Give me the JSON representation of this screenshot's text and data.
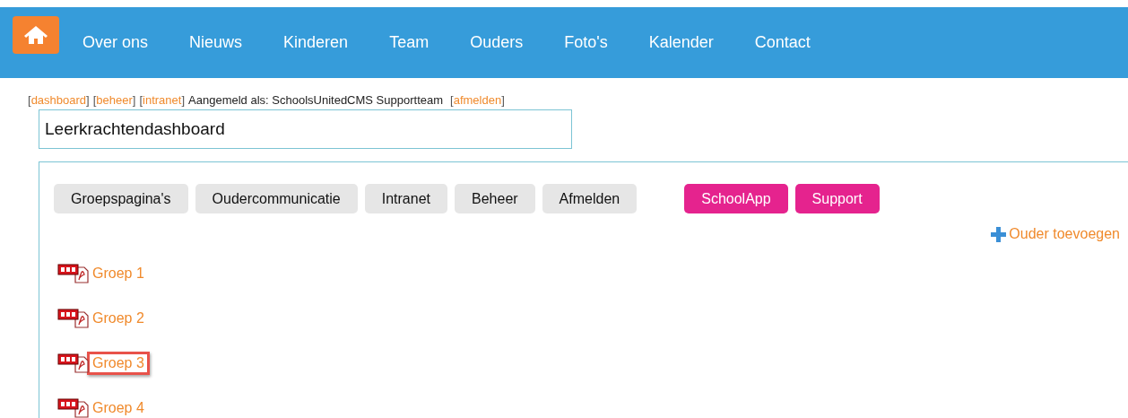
{
  "nav": {
    "items": [
      {
        "label": "Over ons"
      },
      {
        "label": "Nieuws"
      },
      {
        "label": "Kinderen"
      },
      {
        "label": "Team"
      },
      {
        "label": "Ouders"
      },
      {
        "label": "Foto's"
      },
      {
        "label": "Kalender"
      },
      {
        "label": "Contact"
      }
    ]
  },
  "login_bar": {
    "links": [
      {
        "open": "[",
        "label": "dashboard",
        "close": "]"
      },
      {
        "open": "[",
        "label": "beheer",
        "close": "]"
      },
      {
        "open": "[",
        "label": "intranet",
        "close": "]"
      }
    ],
    "status": "Aangemeld als: SchoolsUnitedCMS Supportteam",
    "logout": {
      "open": "[",
      "label": "afmelden",
      "close": "]"
    }
  },
  "title_field": {
    "value": "Leerkrachtendashboard"
  },
  "buttons": [
    {
      "label": "Groepspagina's",
      "kind": "grey"
    },
    {
      "label": "Oudercommunicatie",
      "kind": "grey"
    },
    {
      "label": "Intranet",
      "kind": "grey"
    },
    {
      "label": "Beheer",
      "kind": "grey"
    },
    {
      "label": "Afmelden",
      "kind": "grey"
    },
    {
      "label": "SchoolApp",
      "kind": "pink"
    },
    {
      "label": "Support",
      "kind": "pink"
    }
  ],
  "add_parent": {
    "label": "Ouder toevoegen"
  },
  "groups": [
    {
      "label": "Groep 1",
      "highlighted": false
    },
    {
      "label": "Groep 2",
      "highlighted": false
    },
    {
      "label": "Groep 3",
      "highlighted": true
    },
    {
      "label": "Groep 4",
      "highlighted": false
    }
  ]
}
